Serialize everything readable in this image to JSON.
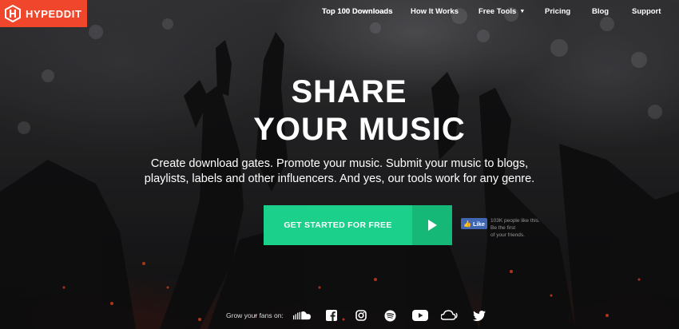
{
  "brand": {
    "name": "HYPEDDIT",
    "color": "#f0462c",
    "icon": "hypeddit-logo-icon"
  },
  "nav": {
    "items": [
      {
        "label": "Top 100 Downloads"
      },
      {
        "label": "How It Works"
      },
      {
        "label": "Free Tools",
        "has_dropdown": true
      },
      {
        "label": "Pricing"
      },
      {
        "label": "Blog"
      },
      {
        "label": "Support"
      }
    ]
  },
  "hero": {
    "title_line1": "SHARE",
    "title_line2": "YOUR MUSIC",
    "subtitle_line1": "Create download gates. Promote your music. Submit your music to blogs,",
    "subtitle_line2": "playlists, labels and other influencers. And yes, our tools work for any genre."
  },
  "cta": {
    "label": "GET STARTED FOR FREE",
    "icon": "play-arrow-icon",
    "color": "#1ad08a",
    "arrow_bg": "#15b877"
  },
  "facebook": {
    "button_label": "Like",
    "text_line1": "103K people like this. Be the first",
    "text_line2": "of your friends.",
    "color": "#4267b2"
  },
  "fans": {
    "label": "Grow your fans on:",
    "icons": [
      "soundcloud-icon",
      "facebook-icon",
      "instagram-icon",
      "spotify-icon",
      "youtube-icon",
      "mixcloud-icon",
      "twitter-icon"
    ]
  }
}
